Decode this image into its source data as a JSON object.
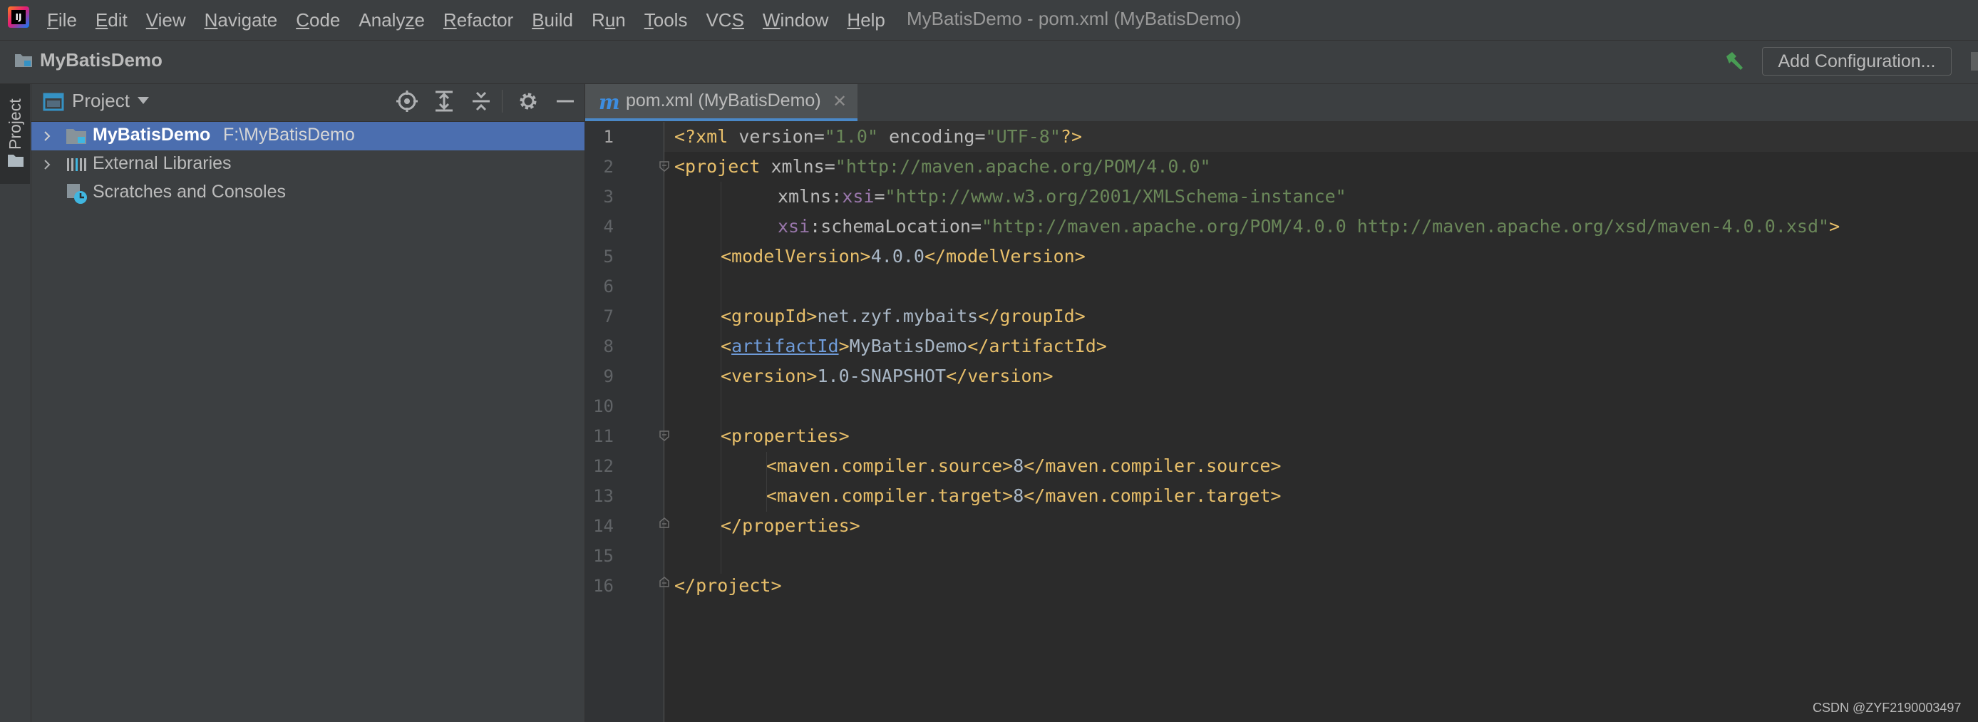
{
  "menubar": {
    "items": [
      "File",
      "Edit",
      "View",
      "Navigate",
      "Code",
      "Analyze",
      "Refactor",
      "Build",
      "Run",
      "Tools",
      "VCS",
      "Window",
      "Help"
    ],
    "mnemonics": [
      "F",
      "E",
      "V",
      "N",
      "C",
      "z",
      "R",
      "B",
      "u",
      "T",
      "S",
      "W",
      "H"
    ],
    "window_title": "MyBatisDemo - pom.xml (MyBatisDemo)"
  },
  "navbar": {
    "project_name": "MyBatisDemo",
    "add_configuration_label": "Add Configuration..."
  },
  "tool_strip": {
    "project_tab_label": "Project"
  },
  "project_panel": {
    "title": "Project",
    "tree": [
      {
        "label": "MyBatisDemo",
        "path": "F:\\MyBatisDemo",
        "selected": true,
        "icon": "module-folder-icon"
      },
      {
        "label": "External Libraries",
        "path": "",
        "selected": false,
        "icon": "libraries-icon"
      },
      {
        "label": "Scratches and Consoles",
        "path": "",
        "selected": false,
        "icon": "scratches-icon"
      }
    ]
  },
  "editor": {
    "tab_label": "pom.xml (MyBatisDemo)",
    "tab_icon": "maven-m-icon",
    "line_numbers": [
      "1",
      "2",
      "3",
      "4",
      "5",
      "6",
      "7",
      "8",
      "9",
      "10",
      "11",
      "12",
      "13",
      "14",
      "15",
      "16"
    ],
    "lines": {
      "l1": {
        "lt": "<?xml",
        "a1": " version",
        "eq1": "=",
        "v1": "\"1.0\"",
        "a2": " encoding",
        "eq2": "=",
        "v2": "\"UTF-8\"",
        "end": "?>"
      },
      "l2": {
        "tag": "<project",
        "attr": " xmlns",
        "eq": "=",
        "val": "\"http://maven.apache.org/POM/4.0.0\""
      },
      "l3": {
        "pre": "xmlns:",
        "ns": "xsi",
        "eq": "=",
        "val": "\"http://www.w3.org/2001/XMLSchema-instance\""
      },
      "l4": {
        "ns": "xsi",
        "attr": ":schemaLocation",
        "eq": "=",
        "val": "\"http://maven.apache.org/POM/4.0.0 http://maven.apache.org/xsd/maven-4.0.0.xsd\"",
        "end": ">"
      },
      "l5": {
        "open": "<modelVersion>",
        "text": "4.0.0",
        "close": "</modelVersion>"
      },
      "l7": {
        "open": "<groupId>",
        "text": "net.zyf.mybaits",
        "close": "</groupId>"
      },
      "l8": {
        "lt": "<",
        "name": "artifactId",
        "gt": ">",
        "text": "MyBatisDemo",
        "close": "</artifactId>"
      },
      "l9": {
        "open": "<version>",
        "text": "1.0-SNAPSHOT",
        "close": "</version>"
      },
      "l11": {
        "open": "<properties>"
      },
      "l12": {
        "open": "<maven.compiler.source>",
        "text": "8",
        "close": "</maven.compiler.source>"
      },
      "l13": {
        "open": "<maven.compiler.target>",
        "text": "8",
        "close": "</maven.compiler.target>"
      },
      "l14": {
        "close": "</properties>"
      },
      "l16": {
        "close": "</project>"
      }
    }
  },
  "watermark": "CSDN @ZYF2190003497",
  "colors": {
    "tag": "#e8bf6a",
    "string": "#6a8759",
    "namespace": "#9876aa",
    "text": "#a9b7c6",
    "selection": "#4b6eaf"
  }
}
